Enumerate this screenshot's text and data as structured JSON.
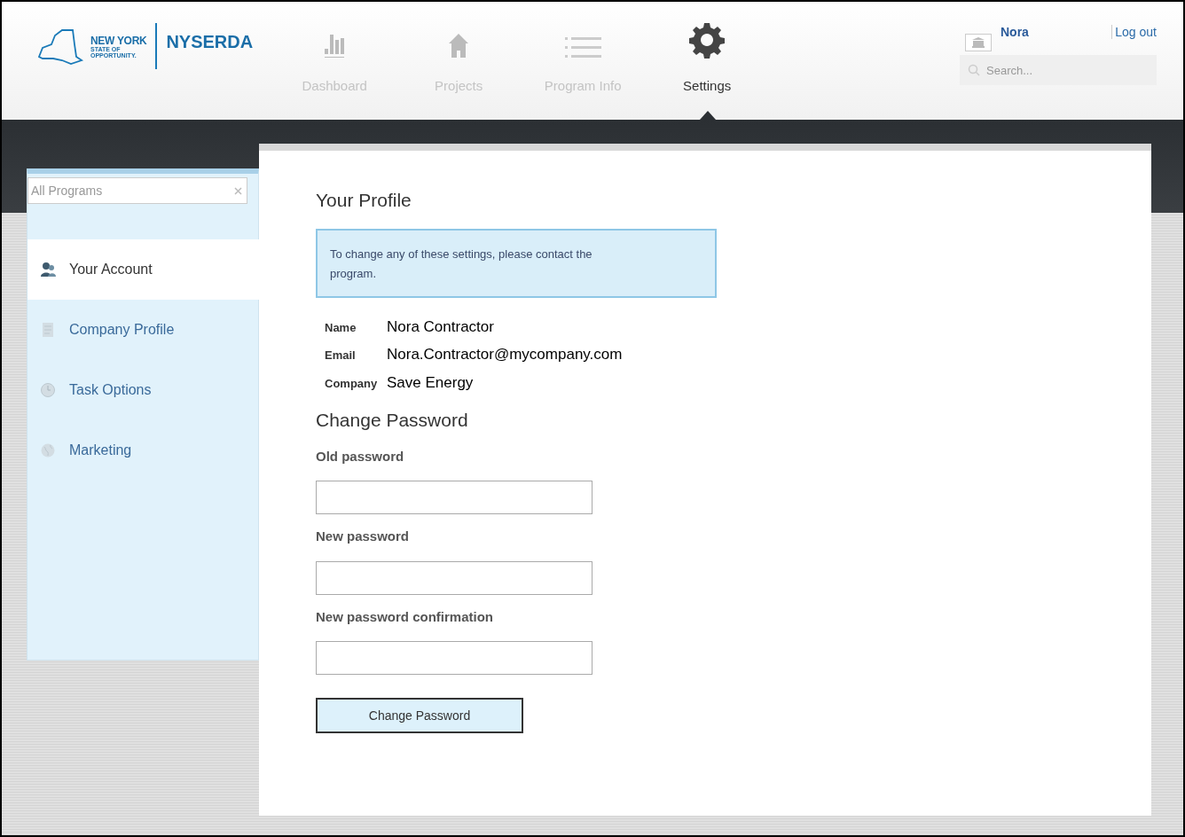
{
  "logo": {
    "state_name": "NEW YORK",
    "tagline_1": "STATE OF",
    "tagline_2": "OPPORTUNITY.",
    "org": "NYSERDA"
  },
  "nav": [
    {
      "label": "Dashboard",
      "kind": "chart",
      "selected": false
    },
    {
      "label": "Projects",
      "kind": "house",
      "selected": false
    },
    {
      "label": "Program Info",
      "kind": "list",
      "selected": false
    },
    {
      "label": "Settings",
      "kind": "gear",
      "selected": true
    }
  ],
  "user": {
    "name": "Nora",
    "logout": "Log out"
  },
  "search": {
    "placeholder": "Search..."
  },
  "sidebar": {
    "program_filter": {
      "placeholder": "All Programs"
    },
    "items": [
      {
        "label": "Your Account",
        "kind": "user",
        "selected": true
      },
      {
        "label": "Company Profile",
        "kind": "document",
        "selected": false
      },
      {
        "label": "Task Options",
        "kind": "clock",
        "selected": false
      },
      {
        "label": "Marketing",
        "kind": "globe",
        "selected": false
      }
    ]
  },
  "profile": {
    "title": "Your Profile",
    "notice": "To change any of these settings, please contact the program.",
    "fields": [
      {
        "label": "Name",
        "value": "Nora Contractor"
      },
      {
        "label": "Email",
        "value": "Nora.Contractor@mycompany.com"
      },
      {
        "label": "Company",
        "value": "Save Energy"
      }
    ]
  },
  "password": {
    "title": "Change Password",
    "fields": [
      {
        "label": "Old password"
      },
      {
        "label": "New password"
      },
      {
        "label": "New password confirmation"
      }
    ],
    "button": "Change Password"
  }
}
